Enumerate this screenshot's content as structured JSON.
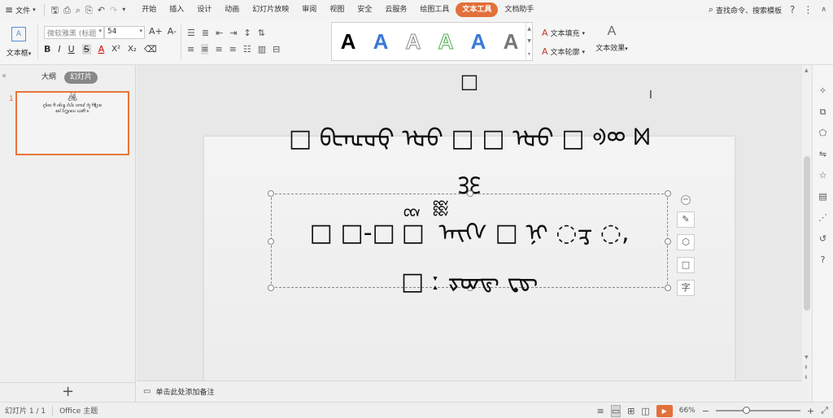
{
  "menubar": {
    "file_label": "文件",
    "tabs": [
      "开始",
      "插入",
      "设计",
      "动画",
      "幻灯片放映",
      "审阅",
      "视图",
      "安全",
      "云服务",
      "绘图工具",
      "文本工具",
      "文档助手"
    ],
    "active_tab": "文本工具",
    "search_label": "查找命令、搜索模板",
    "accent_color": "#e2703a"
  },
  "ribbon": {
    "textbox_label": "文本框",
    "font_name": "微软雅黑 (标题",
    "font_size": "54",
    "grow_label": "A+",
    "shrink_label": "A-",
    "fmt": {
      "bold": "B",
      "italic": "I",
      "underline": "U",
      "strike": "S",
      "color": "A",
      "superscript": "X²",
      "subscript": "X₂"
    },
    "fill_label": "文本填充",
    "outline_label": "文本轮廓",
    "effect_label": "文本效果",
    "gallery_letter": "A"
  },
  "left_panel": {
    "tab_outline": "大纲",
    "tab_slides": "幻灯片",
    "slide_number": "1",
    "thumb_lines": [
      "ᬉ᭄ᬧ᭄ᬭ᭄ᬢᬶ",
      "ᬫᬵᬲ",
      "ᦓᦑᦎ ᦲ ᦵᦑᦻ ᦺᦔᦸ ᦵᦂ᧞ ᦁ ᦆᧀᦉ",
      "ᦸ᧞ ᦷᦗᦶᦢ ᦍᦸᦲ ᦰ"
    ]
  },
  "slide": {
    "line0": "□",
    "line1": "□ ᡋᡄᡅᡆᡇ ᡈᡉ □ □ ᡈᡉ □ ᢀᢁ ᢂ",
    "line2": "ᢃᢄ",
    "line3": "□ □-□ ᢅ□ ᢆ ᢇᢈᢉ □ ᢊ ◌ᢋ ◌,",
    "line4": "□ ː     ᢌᢍᢎ ᢏᢐ"
  },
  "float_tools": {
    "minus": "−",
    "pen": "✎",
    "fill": "⬡",
    "frame": "□",
    "text": "字"
  },
  "notes": {
    "placeholder": "单击此处添加备注"
  },
  "statusbar": {
    "slide_info": "幻灯片 1 / 1",
    "theme": "Office 主题",
    "zoom": "66%",
    "zoom_fraction": 0.35
  }
}
